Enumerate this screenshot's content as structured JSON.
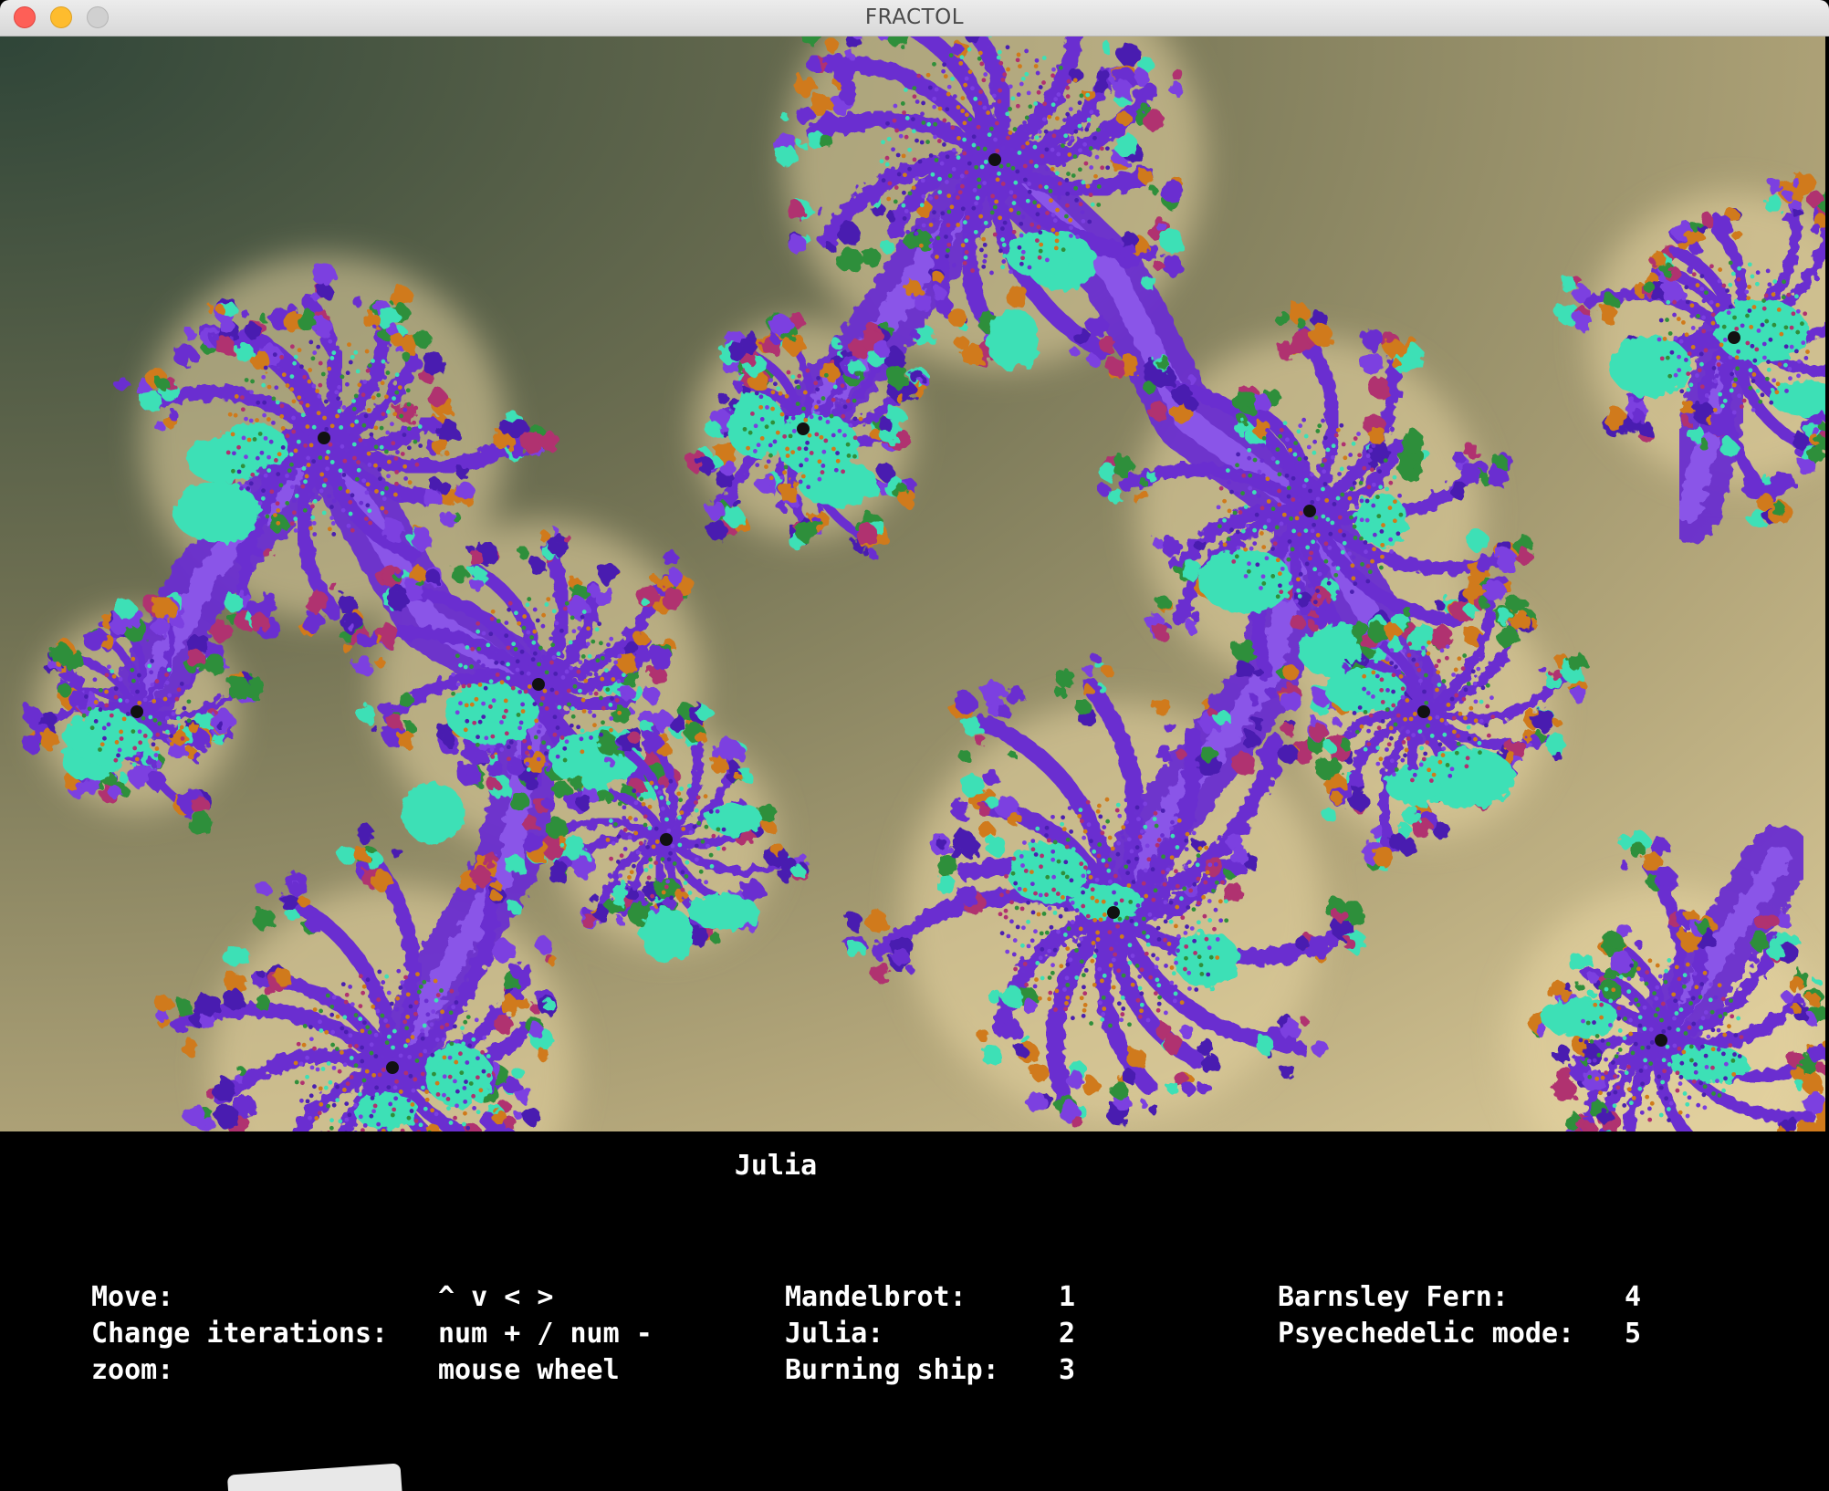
{
  "window": {
    "title": "FRACTOL"
  },
  "fractal": {
    "name": "Julia"
  },
  "colors": {
    "background_dark": "#2f4538",
    "background_light": "#e8d6a3",
    "fractal_purple": "#6a2fd0",
    "fractal_teal": "#3de0b6",
    "fractal_orange": "#d07a1a",
    "panel_bg": "#000000",
    "panel_text": "#ffffff"
  },
  "controls": [
    {
      "key": "Move:",
      "value": "^ v < >"
    },
    {
      "key": "Change iterations:",
      "value": "num + / num -"
    },
    {
      "key": "zoom:",
      "value": "mouse wheel"
    }
  ],
  "fractal_keys": [
    {
      "name": "Mandelbrot:",
      "key": "1"
    },
    {
      "name": "Julia:",
      "key": "2"
    },
    {
      "name": "Burning ship:",
      "key": "3"
    }
  ],
  "fractal_keys_2": [
    {
      "name": "Barnsley Fern:",
      "key": "4"
    },
    {
      "name": "Psyechedelic mode:",
      "key": "5"
    }
  ]
}
